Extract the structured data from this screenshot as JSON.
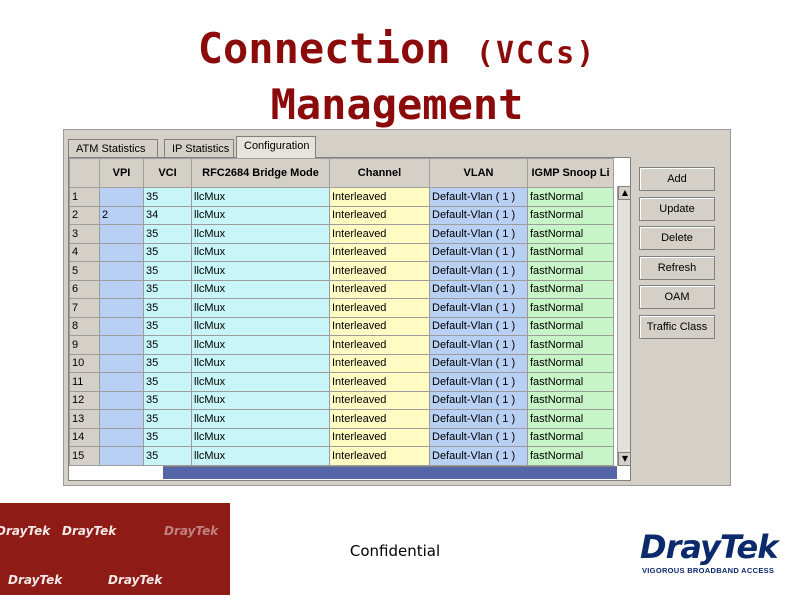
{
  "title": {
    "line1": "Connection",
    "line1_sub": "(VCCs)",
    "line2": "Management"
  },
  "tabs": [
    "ATM Statistics",
    "IP Statistics",
    "Configuration"
  ],
  "active_tab": "Configuration",
  "columns": [
    "",
    "VPI",
    "VCI",
    "RFC2684 Bridge Mode",
    "Channel",
    "VLAN",
    "IGMP Snoop Li"
  ],
  "rows": [
    {
      "n": "1",
      "vpi": "",
      "vci": "35",
      "mode": "llcMux",
      "chan": "Interleaved",
      "vlan": "Default-Vlan ( 1 )",
      "igmp": "fastNormal"
    },
    {
      "n": "2",
      "vpi": "2",
      "vci": "34",
      "mode": "llcMux",
      "chan": "Interleaved",
      "vlan": "Default-Vlan ( 1 )",
      "igmp": "fastNormal"
    },
    {
      "n": "3",
      "vpi": "",
      "vci": "35",
      "mode": "llcMux",
      "chan": "Interleaved",
      "vlan": "Default-Vlan ( 1 )",
      "igmp": "fastNormal"
    },
    {
      "n": "4",
      "vpi": "",
      "vci": "35",
      "mode": "llcMux",
      "chan": "Interleaved",
      "vlan": "Default-Vlan ( 1 )",
      "igmp": "fastNormal"
    },
    {
      "n": "5",
      "vpi": "",
      "vci": "35",
      "mode": "llcMux",
      "chan": "Interleaved",
      "vlan": "Default-Vlan ( 1 )",
      "igmp": "fastNormal"
    },
    {
      "n": "6",
      "vpi": "",
      "vci": "35",
      "mode": "llcMux",
      "chan": "Interleaved",
      "vlan": "Default-Vlan ( 1 )",
      "igmp": "fastNormal"
    },
    {
      "n": "7",
      "vpi": "",
      "vci": "35",
      "mode": "llcMux",
      "chan": "Interleaved",
      "vlan": "Default-Vlan ( 1 )",
      "igmp": "fastNormal"
    },
    {
      "n": "8",
      "vpi": "",
      "vci": "35",
      "mode": "llcMux",
      "chan": "Interleaved",
      "vlan": "Default-Vlan ( 1 )",
      "igmp": "fastNormal"
    },
    {
      "n": "9",
      "vpi": "",
      "vci": "35",
      "mode": "llcMux",
      "chan": "Interleaved",
      "vlan": "Default-Vlan ( 1 )",
      "igmp": "fastNormal"
    },
    {
      "n": "10",
      "vpi": "",
      "vci": "35",
      "mode": "llcMux",
      "chan": "Interleaved",
      "vlan": "Default-Vlan ( 1 )",
      "igmp": "fastNormal"
    },
    {
      "n": "11",
      "vpi": "",
      "vci": "35",
      "mode": "llcMux",
      "chan": "Interleaved",
      "vlan": "Default-Vlan ( 1 )",
      "igmp": "fastNormal"
    },
    {
      "n": "12",
      "vpi": "",
      "vci": "35",
      "mode": "llcMux",
      "chan": "Interleaved",
      "vlan": "Default-Vlan ( 1 )",
      "igmp": "fastNormal"
    },
    {
      "n": "13",
      "vpi": "",
      "vci": "35",
      "mode": "llcMux",
      "chan": "Interleaved",
      "vlan": "Default-Vlan ( 1 )",
      "igmp": "fastNormal"
    },
    {
      "n": "14",
      "vpi": "",
      "vci": "35",
      "mode": "llcMux",
      "chan": "Interleaved",
      "vlan": "Default-Vlan ( 1 )",
      "igmp": "fastNormal"
    },
    {
      "n": "15",
      "vpi": "",
      "vci": "35",
      "mode": "llcMux",
      "chan": "Interleaved",
      "vlan": "Default-Vlan ( 1 )",
      "igmp": "fastNormal"
    }
  ],
  "buttons": [
    "Add",
    "Update",
    "Delete",
    "Refresh",
    "OAM",
    "Traffic Class"
  ],
  "footer": {
    "confidential": "Confidential",
    "logo": "DrayTek",
    "tagline": "VIGOROUS BROADBAND ACCESS",
    "watermark": "DrayTek"
  },
  "colors": {
    "title": "#8b0a0a",
    "footer_bg": "#8e1b15",
    "logo": "#0b2a6b",
    "vpi_col": "#b9d0f5",
    "vci_col": "#c8f5f7",
    "channel_col": "#fffbc2",
    "igmp_col": "#c8f5c8"
  }
}
